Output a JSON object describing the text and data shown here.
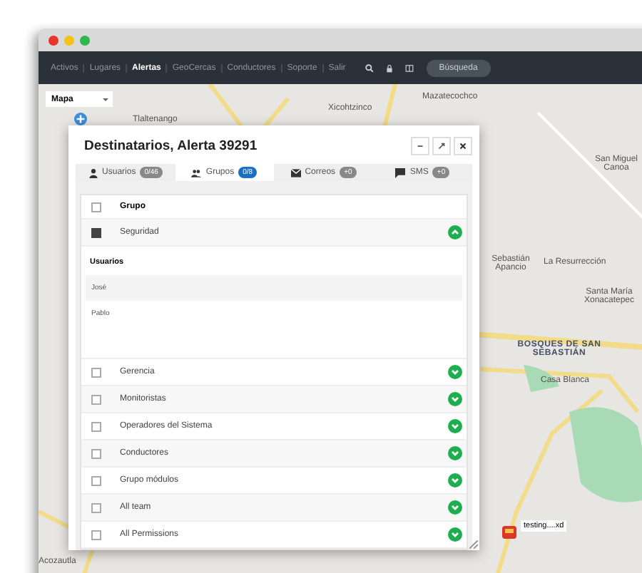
{
  "nav": {
    "items": [
      {
        "label": "Activos",
        "selected": false
      },
      {
        "label": "Lugares",
        "selected": false
      },
      {
        "label": "Alertas",
        "selected": true
      },
      {
        "label": "GeoCercas",
        "selected": false
      },
      {
        "label": "Conductores",
        "selected": false
      },
      {
        "label": "Soporte",
        "selected": false
      },
      {
        "label": "Salir",
        "selected": false
      }
    ],
    "search_button": "Búsqueda"
  },
  "map": {
    "type_select": "Mapa",
    "labels": [
      {
        "text": "Tlaltenango",
        "kind": "place"
      },
      {
        "text": "Xicohtzinco",
        "kind": "place"
      },
      {
        "text": "Mazatecochco",
        "kind": "place"
      },
      {
        "text": "San Miguel Canoa",
        "kind": "place"
      },
      {
        "text": "Sebastián Apancio",
        "kind": "place"
      },
      {
        "text": "La Resurrección",
        "kind": "place"
      },
      {
        "text": "Santa María Xonacatepec",
        "kind": "place"
      },
      {
        "text": "BOSQUES DE SAN SEBASTIÁN",
        "kind": "area"
      },
      {
        "text": "Casa Blanca",
        "kind": "place"
      },
      {
        "text": "Acozautla",
        "kind": "place"
      }
    ],
    "marker": {
      "label": "testing....xd"
    }
  },
  "dialog": {
    "title": "Destinatarios, Alerta 39291",
    "tabs": [
      {
        "label": "Usuarios",
        "badge": "0/46",
        "selected": false
      },
      {
        "label": "Grupos",
        "badge": "0/8",
        "selected": true
      },
      {
        "label": "Correos",
        "badge": "+0",
        "selected": false
      },
      {
        "label": "SMS",
        "badge": "+0",
        "selected": false
      }
    ],
    "table": {
      "header": "Grupo",
      "header_checked": false,
      "rows": [
        {
          "name": "Seguridad",
          "checked": true,
          "expanded": true,
          "users_title": "Usuarios",
          "users": [
            "José",
            "Pablo"
          ]
        },
        {
          "name": "Gerencia",
          "checked": false,
          "expanded": false
        },
        {
          "name": "Monitoristas",
          "checked": false,
          "expanded": false
        },
        {
          "name": "Operadores del Sistema",
          "checked": false,
          "expanded": false
        },
        {
          "name": "Conductores",
          "checked": false,
          "expanded": false
        },
        {
          "name": "Grupo módulos",
          "checked": false,
          "expanded": false
        },
        {
          "name": "All team",
          "checked": false,
          "expanded": false
        },
        {
          "name": "All Permissions",
          "checked": false,
          "expanded": false
        }
      ]
    }
  }
}
